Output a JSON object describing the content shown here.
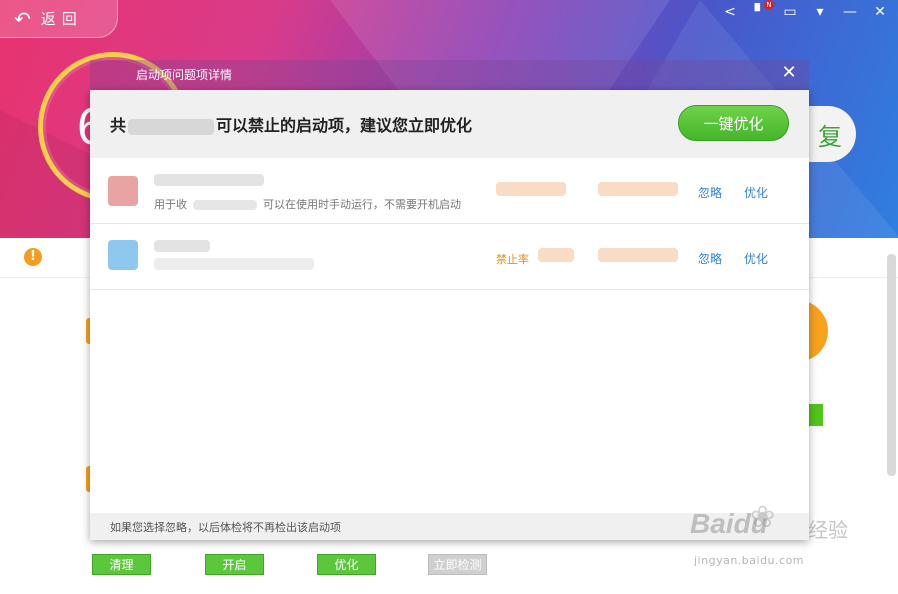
{
  "app": {
    "back_label": "返回",
    "score_digit": "6",
    "repair_char": "复"
  },
  "dialog": {
    "title": "启动项问题项详情",
    "heading_prefix": "共",
    "heading_suffix": "可以禁止的启动项，建议您立即优化",
    "optimize_all_label": "一键优化",
    "close_glyph": "✕",
    "rows": [
      {
        "name": "",
        "description": "用于收",
        "description_tail": "可以在使用时手动运行，不需要开机启动",
        "rate": "",
        "ignore_label": "忽略",
        "optimize_label": "优化"
      },
      {
        "name": "",
        "description": "",
        "description_tail": "",
        "rate": "禁止率",
        "ignore_label": "忽略",
        "optimize_label": "优化"
      }
    ],
    "footer_note": "如果您选择忽略，以后体检将不再检出该启动项"
  },
  "bottom_buttons": [
    {
      "label": "清理",
      "enabled": true
    },
    {
      "label": "开启",
      "enabled": true
    },
    {
      "label": "优化",
      "enabled": true
    },
    {
      "label": "立即检测",
      "enabled": false
    }
  ],
  "watermark": {
    "brand": "Baidu",
    "cn": "经验",
    "url": "jingyan.baidu.com"
  },
  "icons": [
    "back-arrow-icon",
    "share-icon",
    "skin-icon",
    "message-icon",
    "menu-icon",
    "minimize-icon",
    "close-icon",
    "warning-icon",
    "paw-icon"
  ],
  "colors": {
    "primary_green": "#52c41a",
    "link_blue": "#2d83d4",
    "warning_orange": "#f39c1e"
  }
}
